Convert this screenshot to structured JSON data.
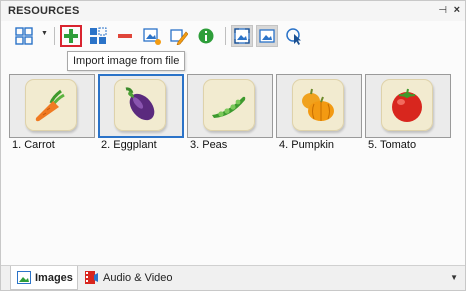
{
  "panel": {
    "title": "RESOURCES",
    "pin_glyph": "⊣",
    "close_glyph": "×"
  },
  "toolbar": {
    "view_mode": {
      "icon": "grid-view-icon",
      "dropdown": "▼"
    },
    "buttons": [
      {
        "name": "import-image-button",
        "icon": "plus-icon"
      },
      {
        "name": "capture-button",
        "icon": "screen-capture-icon"
      },
      {
        "name": "delete-button",
        "icon": "minus-icon"
      },
      {
        "name": "edit-image-button",
        "icon": "image-edit-icon"
      },
      {
        "name": "rename-button",
        "icon": "pencil-icon"
      },
      {
        "name": "info-button",
        "icon": "info-icon"
      },
      {
        "name": "fit-view-button",
        "icon": "fit-image-icon"
      },
      {
        "name": "image-view-button",
        "icon": "image-icon"
      },
      {
        "name": "cursor-button",
        "icon": "cursor-icon"
      }
    ],
    "tooltip": "Import image from file"
  },
  "resources": [
    {
      "label": "1. Carrot",
      "icon": "carrot-icon"
    },
    {
      "label": "2. Eggplant",
      "icon": "eggplant-icon"
    },
    {
      "label": "3. Peas",
      "icon": "peas-icon"
    },
    {
      "label": "4. Pumpkin",
      "icon": "pumpkin-icon"
    },
    {
      "label": "5. Tomato",
      "icon": "tomato-icon"
    }
  ],
  "selected_index": 1,
  "tabs": [
    {
      "label": "Images",
      "active": true,
      "icon": "image-tab-icon"
    },
    {
      "label": "Audio & Video",
      "active": false,
      "icon": "media-tab-icon"
    }
  ],
  "tab_menu_glyph": "▼",
  "colors": {
    "accent_blue": "#2b73c8",
    "highlight_red": "#d9242f",
    "tile_bg": "#f2ebd0"
  }
}
